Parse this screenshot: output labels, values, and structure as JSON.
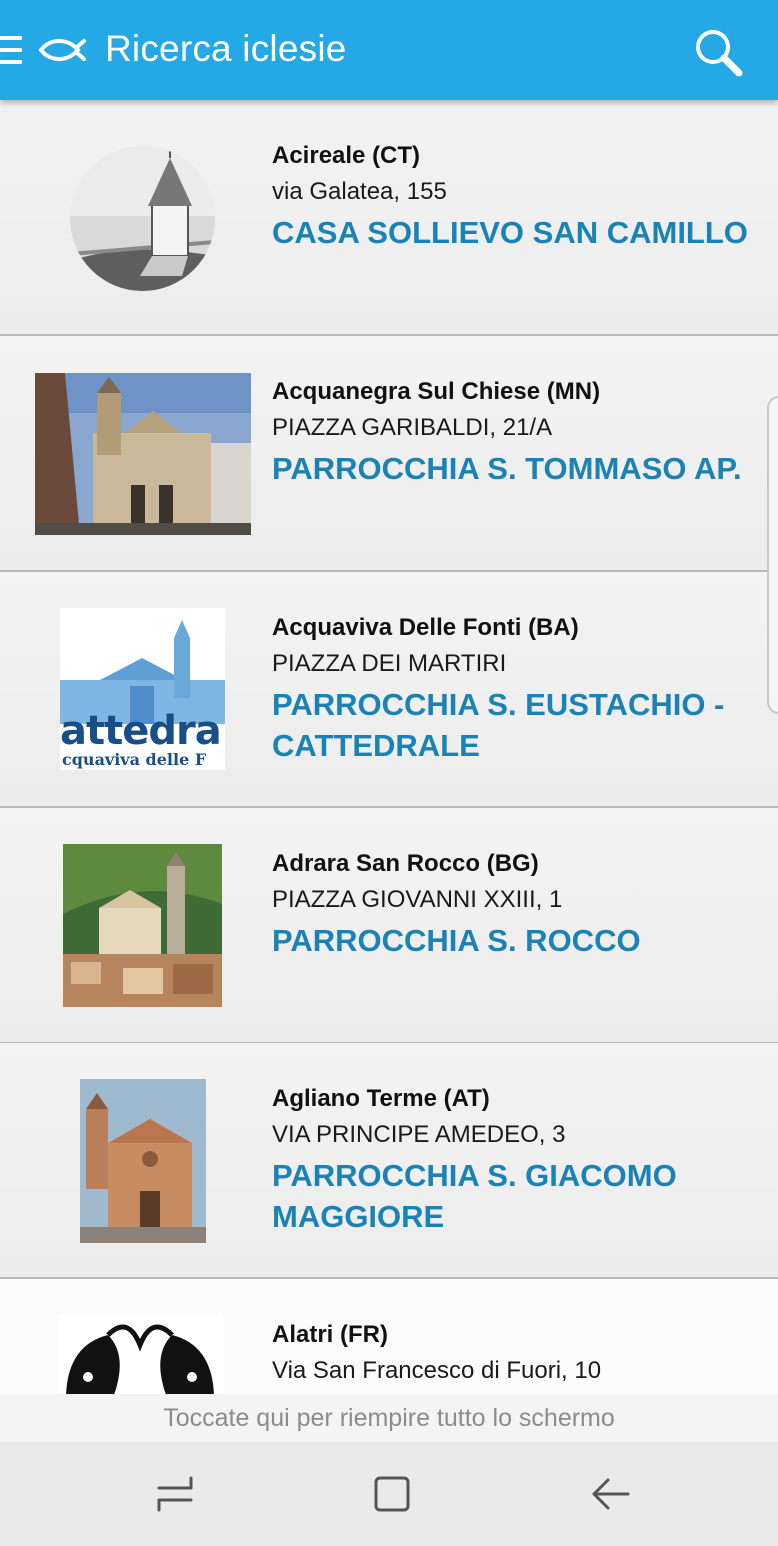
{
  "app": {
    "title": "Ricerca iclesie",
    "accent": "#24a9e6",
    "link_color": "#1b82b6"
  },
  "icons": {
    "menu": "menu-icon",
    "logo": "fish-icon",
    "search": "search-icon",
    "nav_recents": "recents-icon",
    "nav_home": "home-icon",
    "nav_back": "back-icon"
  },
  "churches": [
    {
      "city": "Acireale (CT)",
      "address": "via Galatea, 155",
      "name": "CASA SOLLIEVO SAN CAMILLO"
    },
    {
      "city": "Acquanegra Sul Chiese (MN)",
      "address": "PIAZZA GARIBALDI, 21/A",
      "name": "PARROCCHIA S. TOMMASO AP."
    },
    {
      "city": "Acquaviva Delle Fonti (BA)",
      "address": "PIAZZA DEI MARTIRI",
      "name": "PARROCCHIA S. EUSTACHIO - CATTEDRALE",
      "image_text": "attedra",
      "image_subtext": "cquaviva delle F"
    },
    {
      "city": "Adrara San Rocco (BG)",
      "address": "PIAZZA GIOVANNI XXIII, 1",
      "name": "PARROCCHIA S. ROCCO"
    },
    {
      "city": "Agliano Terme (AT)",
      "address": "VIA PRINCIPE AMEDEO, 3",
      "name": "PARROCCHIA S. GIACOMO MAGGIORE"
    },
    {
      "city": "Alatri (FR)",
      "address": "Via San Francesco di Fuori, 10",
      "name": ""
    }
  ],
  "fullscreen_prompt": "Toccate qui per riempire tutto lo schermo"
}
